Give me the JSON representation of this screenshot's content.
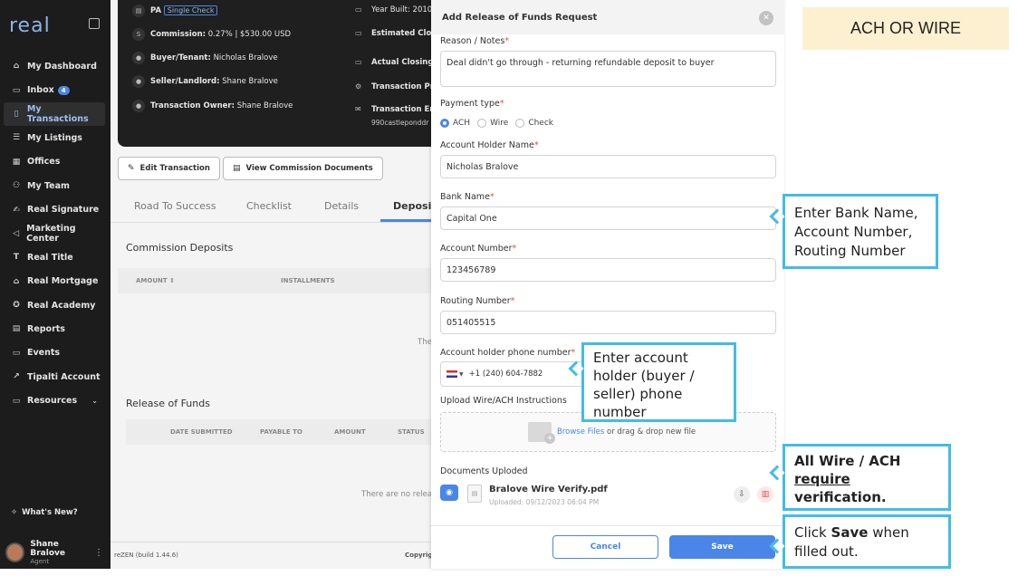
{
  "sidebar": {
    "logo": "real",
    "items": [
      {
        "icon": "⌂",
        "label": "My Dashboard"
      },
      {
        "icon": "▭",
        "label": "Inbox",
        "badge": "4"
      },
      {
        "icon": "▯",
        "label": "My Transactions"
      },
      {
        "icon": "☰",
        "label": "My Listings"
      },
      {
        "icon": "▦",
        "label": "Offices"
      },
      {
        "icon": "⚇",
        "label": "My Team"
      },
      {
        "icon": "✍",
        "label": "Real Signature"
      },
      {
        "icon": "◁",
        "label": "Marketing Center"
      },
      {
        "icon": "T",
        "label": "Real Title"
      },
      {
        "icon": "⌂",
        "label": "Real Mortgage"
      },
      {
        "icon": "✪",
        "label": "Real Academy"
      },
      {
        "icon": "▤",
        "label": "Reports"
      },
      {
        "icon": "▭",
        "label": "Events"
      },
      {
        "icon": "↗",
        "label": "Tipalti Account"
      },
      {
        "icon": "▭",
        "label": "Resources"
      }
    ],
    "whats_new": "What's New?",
    "user_name": "Shane Bralove",
    "user_role": "Agent"
  },
  "transaction": {
    "pa_label": "PA",
    "check_chip": "Single Check",
    "commission_label": "Commission:",
    "commission_value": "0.27% | $530.00 USD",
    "buyer_label": "Buyer/Tenant:",
    "buyer_value": "Nicholas Bralove",
    "seller_label": "Seller/Landlord:",
    "seller_value": "Shane Bralove",
    "owner_label": "Transaction Owner:",
    "owner_value": "Shane Bralove",
    "year_built": "Year Built: 2010",
    "estimated_closing": "Estimated Closin",
    "actual_closing": "Actual Closing D",
    "transaction_prod": "Transaction Prod",
    "transaction_email": "Transaction Ema",
    "email_value": "990castleponddr"
  },
  "actions": {
    "edit": "Edit Transaction",
    "view_commission": "View Commission Documents"
  },
  "tabs": [
    "Road To Success",
    "Checklist",
    "Details",
    "Deposit"
  ],
  "commission_deposits": {
    "title": "Commission Deposits",
    "headers": [
      "AMOUNT ⇕",
      "INSTALLMENTS"
    ],
    "empty": "The"
  },
  "release_of_funds": {
    "title": "Release of Funds",
    "headers": [
      "DATE SUBMITTED",
      "PAYABLE TO",
      "AMOUNT",
      "STATUS"
    ],
    "empty": "There are no relea"
  },
  "footer": {
    "build": "reZEN (build 1.44.6)",
    "copyright": "Copyright"
  },
  "modal": {
    "title": "Add Release of Funds Request",
    "reason_label": "Reason / Notes",
    "reason_value": "Deal didn't go through - returning refundable deposit to buyer",
    "payment_label": "Payment type",
    "payment_options": [
      "ACH",
      "Wire",
      "Check"
    ],
    "payment_selected": "ACH",
    "holder_label": "Account Holder Name",
    "holder_value": "Nicholas Bralove",
    "bank_label": "Bank Name",
    "bank_value": "Capital One",
    "account_label": "Account Number",
    "account_value": "123456789",
    "routing_label": "Routing Number",
    "routing_value": "051405515",
    "phone_label": "Account holder phone number",
    "phone_value": "+1 (240) 604-7882",
    "upload_label": "Upload Wire/ACH Instructions",
    "browse_link": "Browse Files",
    "drop_text": " or drag & drop new file",
    "docs_label": "Documents Uploded",
    "doc_name": "Bralove Wire Verify.pdf",
    "doc_date": "Uploaded: 09/12/2023 06:04 PM",
    "cancel": "Cancel",
    "save": "Save"
  },
  "callouts": {
    "banner": "ACH OR WIRE",
    "bank": "Enter Bank Name, Account Number, Routing Number",
    "phone": "Enter account holder (buyer / seller) phone number",
    "verify_1": "All Wire / ACH",
    "verify_2": "require",
    "verify_3": "verification.",
    "save_1": "Click",
    "save_2": "Save",
    "save_3": "when filled out."
  },
  "colors": {
    "accent": "#4a86e8",
    "callout_border": "#41bde6",
    "banner_bg": "#fdf0d0",
    "sidebar_bg": "#1c1c1c"
  }
}
